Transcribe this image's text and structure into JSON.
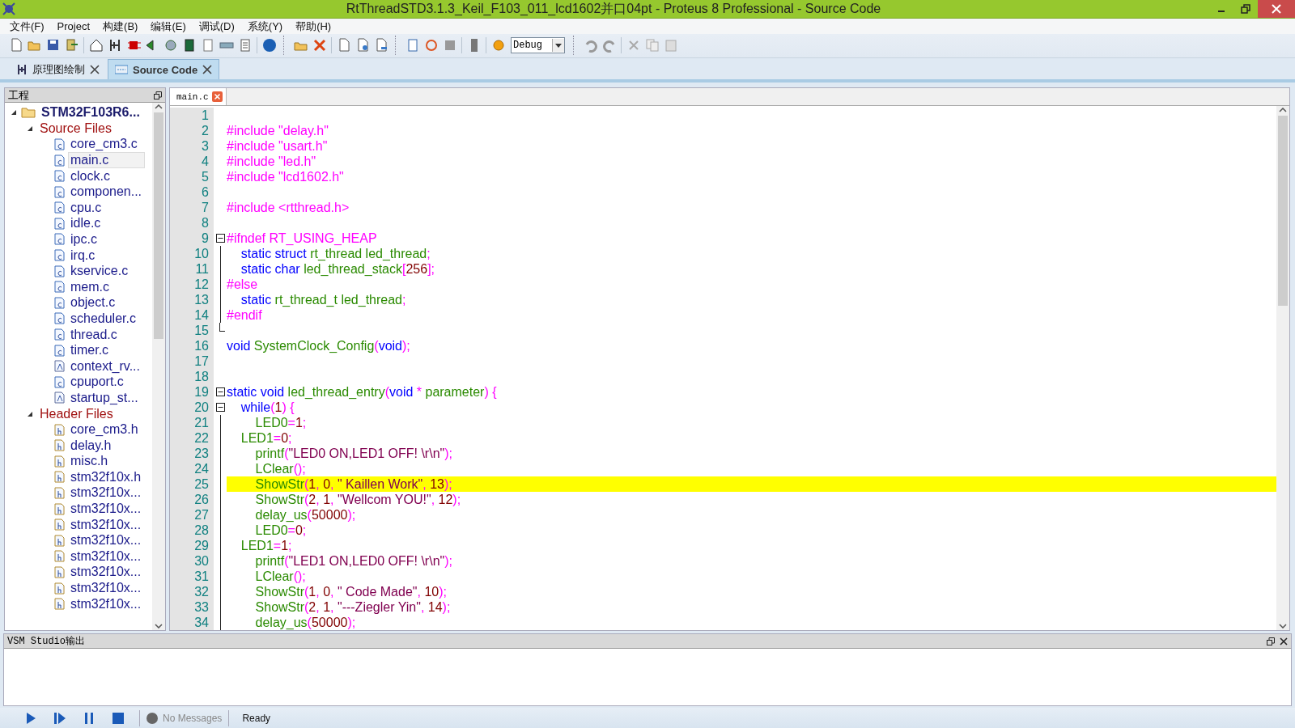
{
  "window": {
    "title": "RtThreadSTD3.1.3_Keil_F103_011_lcd1602并口04pt - Proteus 8 Professional - Source Code"
  },
  "menu": [
    "文件(F)",
    "Project",
    "构建(B)",
    "编辑(E)",
    "调试(D)",
    "系统(Y)",
    "帮助(H)"
  ],
  "toolbar": {
    "configuration": "Debug"
  },
  "doc_tabs": [
    {
      "label": "原理图绘制",
      "selected": false
    },
    {
      "label": "Source Code",
      "selected": true
    }
  ],
  "project_panel": {
    "title": "工程",
    "tree": [
      {
        "label": "STM32F103R6...",
        "kind": "project",
        "expanded": true,
        "selected": false,
        "children": [
          {
            "label": "Source Files",
            "kind": "folder",
            "expanded": true,
            "selected": false,
            "children": [
              {
                "label": "core_cm3.c",
                "kind": "c",
                "selected": false
              },
              {
                "label": "main.c",
                "kind": "c",
                "selected": true
              },
              {
                "label": "clock.c",
                "kind": "c",
                "selected": false
              },
              {
                "label": "componen...",
                "kind": "c",
                "selected": false
              },
              {
                "label": "cpu.c",
                "kind": "c",
                "selected": false
              },
              {
                "label": "idle.c",
                "kind": "c",
                "selected": false
              },
              {
                "label": "ipc.c",
                "kind": "c",
                "selected": false
              },
              {
                "label": "irq.c",
                "kind": "c",
                "selected": false
              },
              {
                "label": "kservice.c",
                "kind": "c",
                "selected": false
              },
              {
                "label": "mem.c",
                "kind": "c",
                "selected": false
              },
              {
                "label": "object.c",
                "kind": "c",
                "selected": false
              },
              {
                "label": "scheduler.c",
                "kind": "c",
                "selected": false
              },
              {
                "label": "thread.c",
                "kind": "c",
                "selected": false
              },
              {
                "label": "timer.c",
                "kind": "c",
                "selected": false
              },
              {
                "label": "context_rv...",
                "kind": "asm",
                "selected": false
              },
              {
                "label": "cpuport.c",
                "kind": "c",
                "selected": false
              },
              {
                "label": "startup_st...",
                "kind": "asm",
                "selected": false
              }
            ]
          },
          {
            "label": "Header Files",
            "kind": "folder",
            "expanded": true,
            "selected": false,
            "children": [
              {
                "label": "core_cm3.h",
                "kind": "h",
                "selected": false
              },
              {
                "label": "delay.h",
                "kind": "h",
                "selected": false
              },
              {
                "label": "misc.h",
                "kind": "h",
                "selected": false
              },
              {
                "label": "stm32f10x.h",
                "kind": "h",
                "selected": false
              },
              {
                "label": "stm32f10x...",
                "kind": "h",
                "selected": false
              },
              {
                "label": "stm32f10x...",
                "kind": "h",
                "selected": false
              },
              {
                "label": "stm32f10x...",
                "kind": "h",
                "selected": false
              },
              {
                "label": "stm32f10x...",
                "kind": "h",
                "selected": false
              },
              {
                "label": "stm32f10x...",
                "kind": "h",
                "selected": false
              },
              {
                "label": "stm32f10x...",
                "kind": "h",
                "selected": false
              },
              {
                "label": "stm32f10x...",
                "kind": "h",
                "selected": false
              },
              {
                "label": "stm32f10x...",
                "kind": "h",
                "selected": false
              }
            ]
          }
        ]
      }
    ]
  },
  "editor": {
    "tabs": [
      {
        "label": "main.c",
        "selected": true
      }
    ],
    "lines": [
      {
        "number": "1",
        "kind": "plain",
        "highlighted": false
      },
      {
        "number": "2",
        "kind": "plain",
        "highlighted": false,
        "tokens": [
          {
            "kind": "pp",
            "text": "#include \"delay.h\""
          }
        ]
      },
      {
        "number": "3",
        "kind": "plain",
        "highlighted": false,
        "tokens": [
          {
            "kind": "pp",
            "text": "#include \"usart.h\""
          }
        ]
      },
      {
        "number": "4",
        "kind": "plain",
        "highlighted": false,
        "tokens": [
          {
            "kind": "pp",
            "text": "#include \"led.h\""
          }
        ]
      },
      {
        "number": "5",
        "kind": "plain",
        "highlighted": false,
        "tokens": [
          {
            "kind": "pp",
            "text": "#include \"lcd1602.h\""
          }
        ]
      },
      {
        "number": "6",
        "kind": "plain",
        "highlighted": false
      },
      {
        "number": "7",
        "kind": "plain",
        "highlighted": false,
        "tokens": [
          {
            "kind": "pp",
            "text": "#include <rtthread.h>"
          }
        ]
      },
      {
        "number": "8",
        "kind": "plain",
        "highlighted": false
      },
      {
        "number": "9",
        "kind": "open",
        "highlighted": false,
        "tokens": [
          {
            "kind": "pp",
            "text": "#ifndef RT_USING_HEAP"
          }
        ]
      },
      {
        "number": "10",
        "kind": "inside",
        "highlighted": false,
        "tokens": [
          {
            "kind": "kw",
            "text": "    static struct"
          },
          {
            "kind": "id",
            "text": " rt_thread led_thread"
          },
          {
            "kind": "op",
            "text": ";"
          }
        ]
      },
      {
        "number": "11",
        "kind": "inside",
        "highlighted": false,
        "tokens": [
          {
            "kind": "kw",
            "text": "    static char"
          },
          {
            "kind": "id",
            "text": " led_thread_stack"
          },
          {
            "kind": "op",
            "text": "["
          },
          {
            "kind": "num",
            "text": "256"
          },
          {
            "kind": "op",
            "text": "];"
          }
        ]
      },
      {
        "number": "12",
        "kind": "inside",
        "highlighted": false,
        "tokens": [
          {
            "kind": "pp",
            "text": "#else"
          }
        ]
      },
      {
        "number": "13",
        "kind": "inside",
        "highlighted": false,
        "tokens": [
          {
            "kind": "kw",
            "text": "    static"
          },
          {
            "kind": "id",
            "text": " rt_thread_t led_thread"
          },
          {
            "kind": "op",
            "text": ";"
          }
        ]
      },
      {
        "number": "14",
        "kind": "inside",
        "highlighted": false,
        "tokens": [
          {
            "kind": "pp",
            "text": "#endif"
          }
        ]
      },
      {
        "number": "15",
        "kind": "end",
        "highlighted": false
      },
      {
        "number": "16",
        "kind": "plain",
        "highlighted": false,
        "tokens": [
          {
            "kind": "kw",
            "text": "void"
          },
          {
            "kind": "id",
            "text": " SystemClock_Config"
          },
          {
            "kind": "op",
            "text": "("
          },
          {
            "kind": "kw",
            "text": "void"
          },
          {
            "kind": "op",
            "text": ");"
          }
        ]
      },
      {
        "number": "17",
        "kind": "plain",
        "highlighted": false
      },
      {
        "number": "18",
        "kind": "plain",
        "highlighted": false
      },
      {
        "number": "19",
        "kind": "open",
        "highlighted": false,
        "tokens": [
          {
            "kind": "kw",
            "text": "static void"
          },
          {
            "kind": "id",
            "text": " led_thread_entry"
          },
          {
            "kind": "op",
            "text": "("
          },
          {
            "kind": "kw",
            "text": "void"
          },
          {
            "kind": "op",
            "text": " * "
          },
          {
            "kind": "id",
            "text": "parameter"
          },
          {
            "kind": "op",
            "text": ") {"
          }
        ]
      },
      {
        "number": "20",
        "kind": "open",
        "highlighted": false,
        "tokens": [
          {
            "kind": "kw",
            "text": "    while"
          },
          {
            "kind": "op",
            "text": "("
          },
          {
            "kind": "num",
            "text": "1"
          },
          {
            "kind": "op",
            "text": ") {"
          }
        ]
      },
      {
        "number": "21",
        "kind": "inside",
        "highlighted": false,
        "tokens": [
          {
            "kind": "id",
            "text": "        LED0"
          },
          {
            "kind": "op",
            "text": "="
          },
          {
            "kind": "num",
            "text": "1"
          },
          {
            "kind": "op",
            "text": ";"
          }
        ]
      },
      {
        "number": "22",
        "kind": "inside",
        "highlighted": false,
        "tokens": [
          {
            "kind": "id",
            "text": "    LED1"
          },
          {
            "kind": "op",
            "text": "="
          },
          {
            "kind": "num",
            "text": "0"
          },
          {
            "kind": "op",
            "text": ";"
          }
        ]
      },
      {
        "number": "23",
        "kind": "inside",
        "highlighted": false,
        "tokens": [
          {
            "kind": "id",
            "text": "        printf"
          },
          {
            "kind": "op",
            "text": "("
          },
          {
            "kind": "str",
            "text": "\"LED0 ON,LED1 OFF! \\r\\n\""
          },
          {
            "kind": "op",
            "text": ");"
          }
        ]
      },
      {
        "number": "24",
        "kind": "inside",
        "highlighted": false,
        "tokens": [
          {
            "kind": "id",
            "text": "        LClear"
          },
          {
            "kind": "op",
            "text": "();"
          }
        ]
      },
      {
        "number": "25",
        "kind": "inside",
        "highlighted": true,
        "tokens": [
          {
            "kind": "id",
            "text": "        ShowStr"
          },
          {
            "kind": "op",
            "text": "("
          },
          {
            "kind": "num",
            "text": "1"
          },
          {
            "kind": "op",
            "text": ", "
          },
          {
            "kind": "num",
            "text": "0"
          },
          {
            "kind": "op",
            "text": ", "
          },
          {
            "kind": "str",
            "text": "\" Kaillen Work\""
          },
          {
            "kind": "op",
            "text": ", "
          },
          {
            "kind": "num",
            "text": "13"
          },
          {
            "kind": "op",
            "text": ");"
          }
        ]
      },
      {
        "number": "26",
        "kind": "inside",
        "highlighted": false,
        "tokens": [
          {
            "kind": "id",
            "text": "        ShowStr"
          },
          {
            "kind": "op",
            "text": "("
          },
          {
            "kind": "num",
            "text": "2"
          },
          {
            "kind": "op",
            "text": ", "
          },
          {
            "kind": "num",
            "text": "1"
          },
          {
            "kind": "op",
            "text": ", "
          },
          {
            "kind": "str",
            "text": "\"Wellcom YOU!\""
          },
          {
            "kind": "op",
            "text": ", "
          },
          {
            "kind": "num",
            "text": "12"
          },
          {
            "kind": "op",
            "text": ");"
          }
        ]
      },
      {
        "number": "27",
        "kind": "inside",
        "highlighted": false,
        "tokens": [
          {
            "kind": "id",
            "text": "        delay_us"
          },
          {
            "kind": "op",
            "text": "("
          },
          {
            "kind": "num",
            "text": "50000"
          },
          {
            "kind": "op",
            "text": ");"
          }
        ]
      },
      {
        "number": "28",
        "kind": "inside",
        "highlighted": false,
        "tokens": [
          {
            "kind": "id",
            "text": "        LED0"
          },
          {
            "kind": "op",
            "text": "="
          },
          {
            "kind": "num",
            "text": "0"
          },
          {
            "kind": "op",
            "text": ";"
          }
        ]
      },
      {
        "number": "29",
        "kind": "inside",
        "highlighted": false,
        "tokens": [
          {
            "kind": "id",
            "text": "    LED1"
          },
          {
            "kind": "op",
            "text": "="
          },
          {
            "kind": "num",
            "text": "1"
          },
          {
            "kind": "op",
            "text": ";"
          }
        ]
      },
      {
        "number": "30",
        "kind": "inside",
        "highlighted": false,
        "tokens": [
          {
            "kind": "id",
            "text": "        printf"
          },
          {
            "kind": "op",
            "text": "("
          },
          {
            "kind": "str",
            "text": "\"LED1 ON,LED0 OFF! \\r\\n\""
          },
          {
            "kind": "op",
            "text": ");"
          }
        ]
      },
      {
        "number": "31",
        "kind": "inside",
        "highlighted": false,
        "tokens": [
          {
            "kind": "id",
            "text": "        LClear"
          },
          {
            "kind": "op",
            "text": "();"
          }
        ]
      },
      {
        "number": "32",
        "kind": "inside",
        "highlighted": false,
        "tokens": [
          {
            "kind": "id",
            "text": "        ShowStr"
          },
          {
            "kind": "op",
            "text": "("
          },
          {
            "kind": "num",
            "text": "1"
          },
          {
            "kind": "op",
            "text": ", "
          },
          {
            "kind": "num",
            "text": "0"
          },
          {
            "kind": "op",
            "text": ", "
          },
          {
            "kind": "str",
            "text": "\" Code Made\""
          },
          {
            "kind": "op",
            "text": ", "
          },
          {
            "kind": "num",
            "text": "10"
          },
          {
            "kind": "op",
            "text": ");"
          }
        ]
      },
      {
        "number": "33",
        "kind": "inside",
        "highlighted": false,
        "tokens": [
          {
            "kind": "id",
            "text": "        ShowStr"
          },
          {
            "kind": "op",
            "text": "("
          },
          {
            "kind": "num",
            "text": "2"
          },
          {
            "kind": "op",
            "text": ", "
          },
          {
            "kind": "num",
            "text": "1"
          },
          {
            "kind": "op",
            "text": ", "
          },
          {
            "kind": "str",
            "text": "\"---Ziegler Yin\""
          },
          {
            "kind": "op",
            "text": ", "
          },
          {
            "kind": "num",
            "text": "14"
          },
          {
            "kind": "op",
            "text": ");"
          }
        ]
      },
      {
        "number": "34",
        "kind": "inside",
        "highlighted": false,
        "tokens": [
          {
            "kind": "id",
            "text": "        delay_us"
          },
          {
            "kind": "op",
            "text": "("
          },
          {
            "kind": "num",
            "text": "50000"
          },
          {
            "kind": "op",
            "text": ");"
          }
        ]
      }
    ]
  },
  "output_panel": {
    "title": "VSM Studio输出"
  },
  "status_bar": {
    "message": "No Messages",
    "status": "Ready"
  }
}
